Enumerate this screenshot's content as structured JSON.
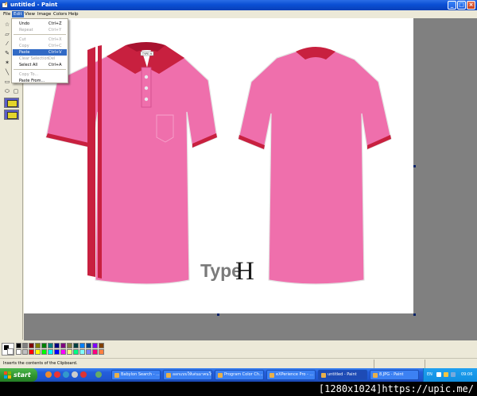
{
  "window": {
    "title": "untitled - Paint"
  },
  "menubar": {
    "items": [
      "File",
      "Edit",
      "View",
      "Image",
      "Colors",
      "Help"
    ]
  },
  "edit_menu": {
    "items": [
      {
        "label": "Undo",
        "shortcut": "Ctrl+Z",
        "enabled": true
      },
      {
        "label": "Repeat",
        "shortcut": "Ctrl+Y",
        "enabled": false
      },
      {
        "label": "Cut",
        "shortcut": "Ctrl+X",
        "enabled": false
      },
      {
        "label": "Copy",
        "shortcut": "Ctrl+C",
        "enabled": false
      },
      {
        "label": "Paste",
        "shortcut": "Ctrl+V",
        "enabled": true,
        "highlighted": true
      },
      {
        "label": "Clear Selection",
        "shortcut": "Del",
        "enabled": false
      },
      {
        "label": "Select All",
        "shortcut": "Ctrl+A",
        "enabled": true
      },
      {
        "label": "Copy To...",
        "shortcut": "",
        "enabled": false
      },
      {
        "label": "Paste From...",
        "shortcut": "",
        "enabled": true
      }
    ]
  },
  "canvas": {
    "shirt_color": "#ef6fac",
    "accent_color": "#c8203f",
    "collar_label": "Type",
    "collar_tag_text": "TYPE H",
    "caption_word": "Type",
    "caption_letter": "H"
  },
  "palette": {
    "colors": [
      "#000000",
      "#808080",
      "#800000",
      "#808000",
      "#008000",
      "#008080",
      "#000080",
      "#800080",
      "#808040",
      "#004040",
      "#0080ff",
      "#004080",
      "#8000ff",
      "#804000",
      "#ffffff",
      "#c0c0c0",
      "#ff0000",
      "#ffff00",
      "#00ff00",
      "#00ffff",
      "#0000ff",
      "#ff00ff",
      "#ffff80",
      "#00ff80",
      "#80ffff",
      "#8080ff",
      "#ff0080",
      "#ff8040"
    ]
  },
  "statusbar": {
    "text": "Inserts the contents of the Clipboard."
  },
  "taskbar": {
    "start_label": "start",
    "tasks": [
      {
        "label": "Babylon Search - ...",
        "active": false
      },
      {
        "label": "ออกแบบให้เด่นมาคนใน...",
        "active": false
      },
      {
        "label": "Program Color Ch...",
        "active": false
      },
      {
        "label": "eXPerience Pro - ...",
        "active": false
      },
      {
        "label": "untitled - Paint",
        "active": true
      },
      {
        "label": "8.JPG - Paint",
        "active": false
      }
    ],
    "language": "EN",
    "clock": "09:06"
  },
  "watermark": "[1280x1024]https://upic.me/"
}
